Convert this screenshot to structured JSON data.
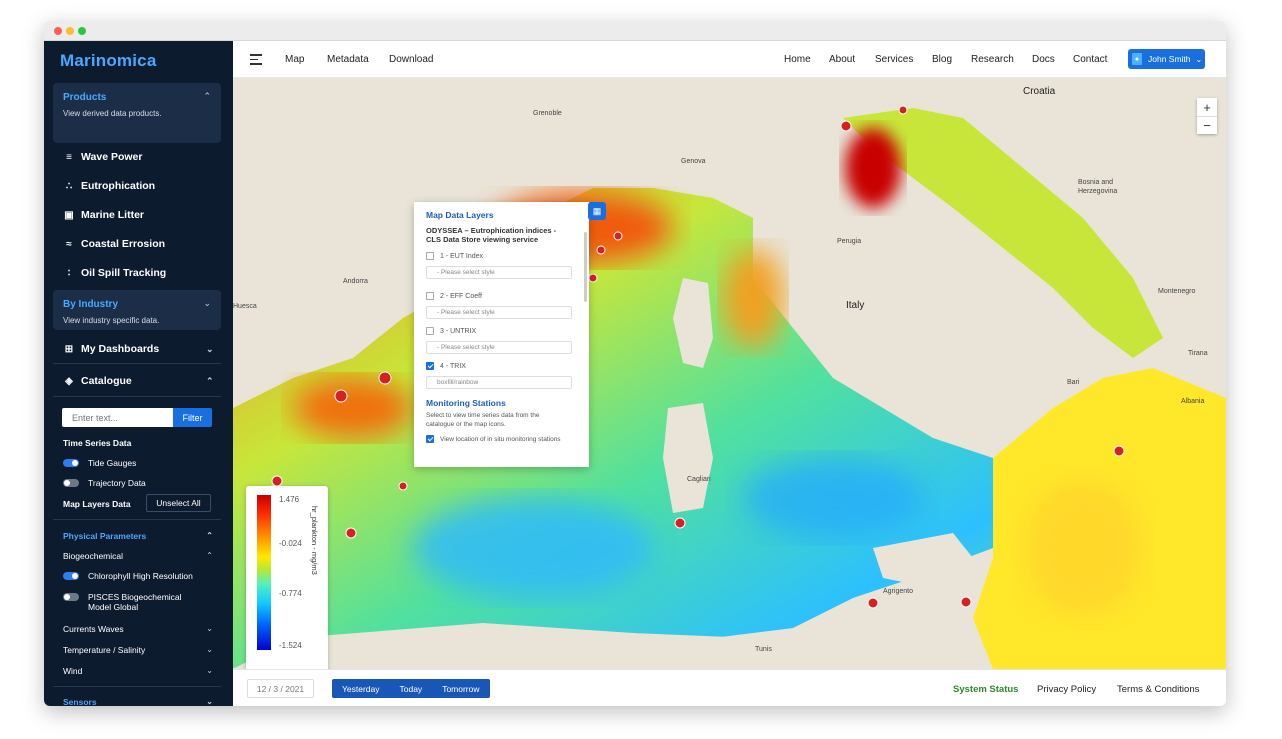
{
  "app": {
    "brand": "Marinomica"
  },
  "sidebar": {
    "products": {
      "title": "Products",
      "subtitle": "View derived data products.",
      "chevron": "up"
    },
    "product_items": [
      {
        "label": "Wave Power",
        "icon": "waves-icon"
      },
      {
        "label": "Eutrophication",
        "icon": "molecule-icon"
      },
      {
        "label": "Marine Litter",
        "icon": "trash-icon"
      },
      {
        "label": "Coastal Errosion",
        "icon": "coast-icon"
      },
      {
        "label": "Oil Spill Tracking",
        "icon": "droplets-icon"
      }
    ],
    "by_industry": {
      "title": "By Industry",
      "subtitle": "View industry specific data.",
      "chevron": "down"
    },
    "dashboards": {
      "label": "My Dashboards",
      "icon": "grid-icon"
    },
    "catalogue": {
      "label": "Catalogue",
      "icon": "layers-icon"
    },
    "search": {
      "placeholder": "Enter text...",
      "button": "Filter"
    },
    "time_series": {
      "title": "Time Series Data",
      "items": [
        {
          "label": "Tide Gauges",
          "on": true
        },
        {
          "label": "Trajectory Data",
          "on": false
        }
      ]
    },
    "map_layers": {
      "title": "Map Layers Data",
      "unselect": "Unselect All"
    },
    "physical_parameters": "Physical Parameters",
    "biogeochemical": {
      "label": "Biogeochemical",
      "items": [
        {
          "label": "Chlorophyll High Resolution",
          "on": true
        },
        {
          "label": "PISCES Biogeochemical Model Global",
          "on": false
        }
      ]
    },
    "categories": [
      "Currents Waves",
      "Temperature / Salinity",
      "Wind"
    ],
    "sensors": "Sensors"
  },
  "topbar": {
    "left_links": [
      "Map",
      "Metadata",
      "Download"
    ],
    "right_links": [
      "Home",
      "About",
      "Services",
      "Blog",
      "Research",
      "Docs",
      "Contact"
    ],
    "user": "John Smith"
  },
  "map": {
    "zoom_in": "+",
    "zoom_out": "−",
    "places": {
      "croatia": "Croatia",
      "bosnia": "Bosnia and Herzegovina",
      "italy": "Italy",
      "andorra": "Andorra",
      "montenegro": "Montenegro",
      "albania": "Albania",
      "tirana": "Tirana",
      "genova": "Genova",
      "grenoble": "Grenoble",
      "cagliari": "Cagliari",
      "agrigento": "Agrigento",
      "tunis": "Tunis",
      "huesca": "Huesca",
      "perugia": "Perugia",
      "bari": "Bari"
    }
  },
  "layers_panel": {
    "title": "Map Data Layers",
    "service": "ODYSSEA – Eutrophication indices - CLS Data Store viewing service",
    "layers": [
      {
        "label": "1 - EUT Index",
        "checked": false,
        "style": "- Please select style"
      },
      {
        "label": "2 - EFF Coeff",
        "checked": false,
        "style": "- Please select style"
      },
      {
        "label": "3 - UNTRIX",
        "checked": false,
        "style": "- Please select style"
      },
      {
        "label": "4 - TRIX",
        "checked": true,
        "style": "boxfill/rainbow"
      }
    ],
    "stations_title": "Monitoring Stations",
    "stations_desc": "Select to view time series data from the catalogue or the map icons.",
    "stations_check": "View location of in situ monitoring stations"
  },
  "legend": {
    "ticks": [
      "1.476",
      "-0.024",
      "-0.774",
      "-1.524"
    ],
    "unit": "hr_plankton - mg/m3"
  },
  "bottombar": {
    "date": "12 / 3 / 2021",
    "days": [
      "Yesterday",
      "Today",
      "Tomorrow"
    ],
    "links": [
      "System Status",
      "Privacy Policy",
      "Terms & Conditions"
    ]
  }
}
